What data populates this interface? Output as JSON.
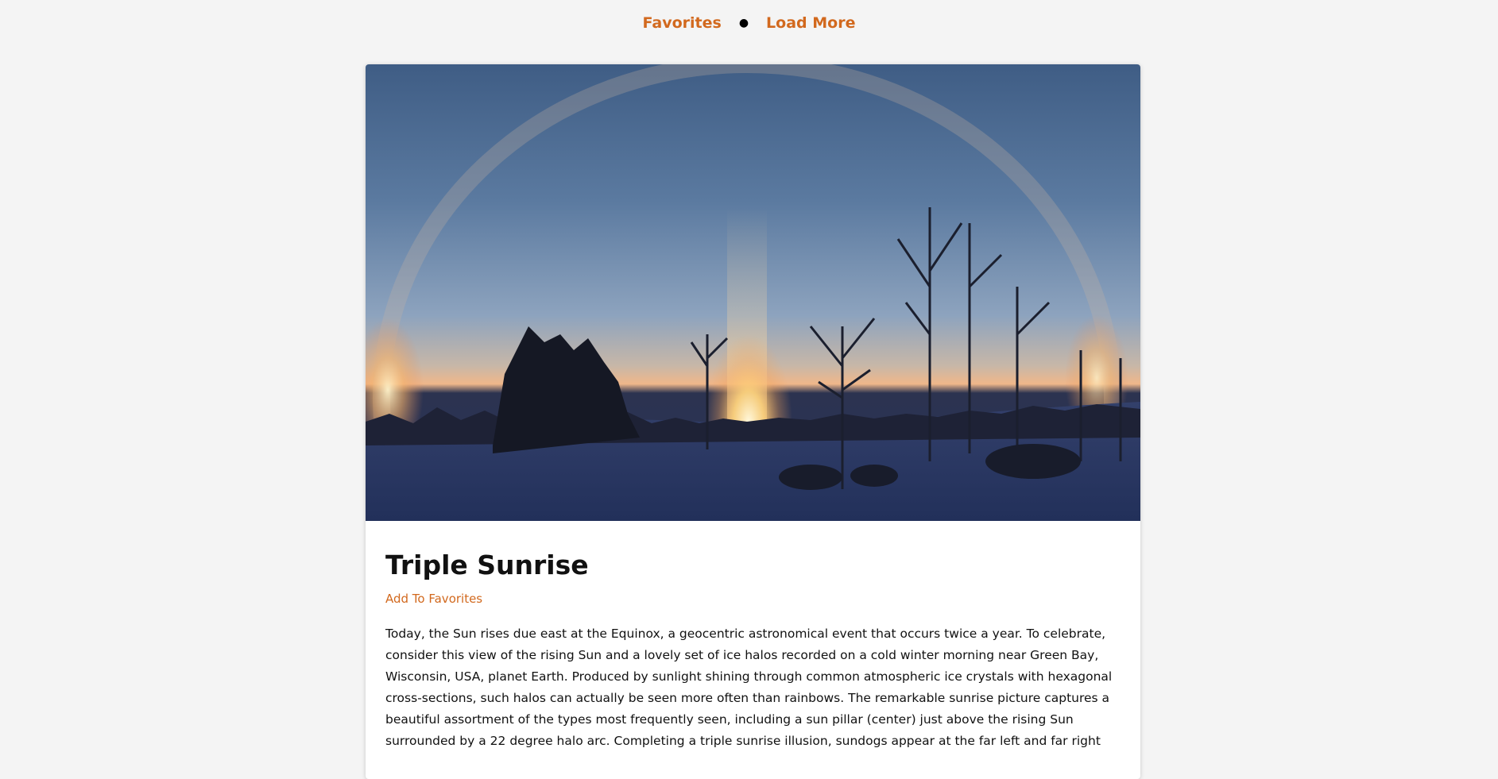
{
  "nav": {
    "favorites_label": "Favorites",
    "separator": "●",
    "load_more_label": "Load More"
  },
  "post": {
    "title": "Triple Sunrise",
    "add_favorite_label": "Add To Favorites",
    "description": "Today, the Sun rises due east at the Equinox, a geocentric astronomical event that occurs twice a year. To celebrate, consider this view of the rising Sun and a lovely set of ice halos recorded on a cold winter morning near Green Bay, Wisconsin, USA, planet Earth. Produced by sunlight shining through common atmospheric ice crystals with hexagonal cross-sections, such halos can actually be seen more often than rainbows. The remarkable sunrise picture captures a beautiful assortment of the types most frequently seen, including a sun pillar (center) just above the rising Sun surrounded by a 22 degree halo arc. Completing a triple sunrise illusion, sundogs appear at the far left and far right"
  },
  "colors": {
    "accent": "#d2691e",
    "page_background": "#f4f4f4",
    "card_background": "#ffffff"
  }
}
